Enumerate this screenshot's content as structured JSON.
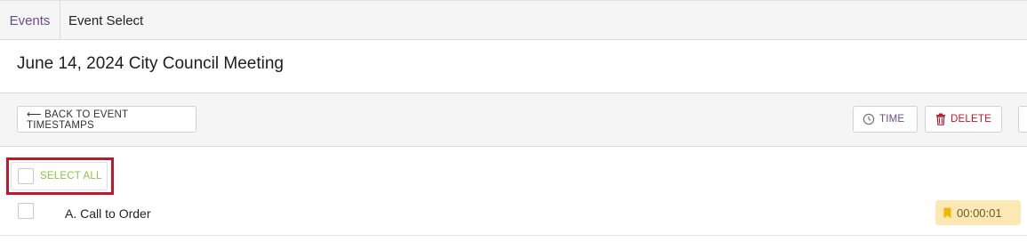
{
  "breadcrumb": {
    "root": "Events",
    "current": "Event Select"
  },
  "page": {
    "title": "June 14, 2024 City Council Meeting"
  },
  "toolbar": {
    "back_label": "⟵ BACK TO EVENT TIMESTAMPS",
    "time_label": "TIME",
    "delete_label": "DELETE"
  },
  "selection": {
    "select_all_label": "SELECT ALL",
    "select_all_checked": false
  },
  "items": [
    {
      "label": "A. Call to Order",
      "timestamp": "00:00:01",
      "checked": false
    }
  ],
  "icons": {
    "time": "clock-icon",
    "delete": "trash-icon",
    "timestamp": "bookmark-icon"
  },
  "colors": {
    "accent_purple": "#6b4d8a",
    "danger_red": "#c0182b",
    "select_green": "#8fbf4d",
    "timestamp_bg": "#fce8b2"
  }
}
